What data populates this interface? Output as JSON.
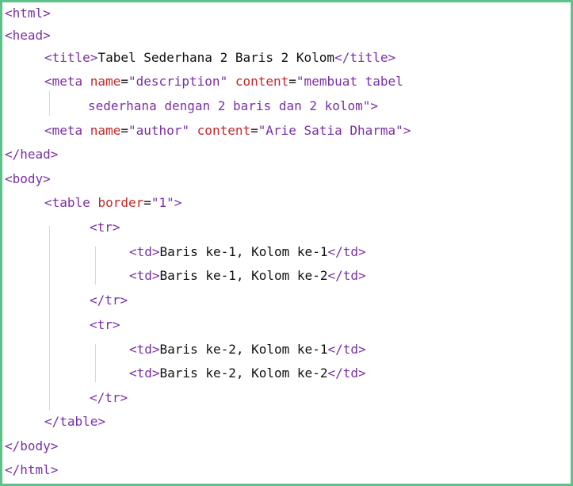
{
  "code_lines": [
    {
      "parts": [
        {
          "t": "tag",
          "s": "<html>"
        }
      ]
    },
    {
      "parts": [
        {
          "t": "tag",
          "s": "<head>"
        }
      ]
    },
    {
      "parts": [
        {
          "t": "tag",
          "s": "<title>"
        },
        {
          "t": "txt",
          "s": "Tabel Sederhana 2 Baris 2 Kolom"
        },
        {
          "t": "tag",
          "s": "</title>"
        }
      ]
    },
    {
      "parts": [
        {
          "t": "tag",
          "s": "<meta "
        },
        {
          "t": "attr",
          "s": "name"
        },
        {
          "t": "eq",
          "s": "="
        },
        {
          "t": "val",
          "s": "\"description\""
        },
        {
          "t": "tag",
          "s": " "
        },
        {
          "t": "attr",
          "s": "content"
        },
        {
          "t": "eq",
          "s": "="
        },
        {
          "t": "val",
          "s": "\"membuat tabel"
        }
      ]
    },
    {
      "parts": [
        {
          "t": "val",
          "s": "sederhana dengan 2 baris dan 2 kolom\""
        },
        {
          "t": "tag",
          "s": ">"
        }
      ]
    },
    {
      "parts": [
        {
          "t": "tag",
          "s": "<meta "
        },
        {
          "t": "attr",
          "s": "name"
        },
        {
          "t": "eq",
          "s": "="
        },
        {
          "t": "val",
          "s": "\"author\""
        },
        {
          "t": "tag",
          "s": " "
        },
        {
          "t": "attr",
          "s": "content"
        },
        {
          "t": "eq",
          "s": "="
        },
        {
          "t": "val",
          "s": "\"Arie Satia Dharma\""
        },
        {
          "t": "tag",
          "s": ">"
        }
      ]
    },
    {
      "parts": [
        {
          "t": "tag",
          "s": "</head>"
        }
      ]
    },
    {
      "parts": [
        {
          "t": "tag",
          "s": "<body>"
        }
      ]
    },
    {
      "parts": [
        {
          "t": "tag",
          "s": "<table "
        },
        {
          "t": "attr",
          "s": "border"
        },
        {
          "t": "eq",
          "s": "="
        },
        {
          "t": "val",
          "s": "\"1\""
        },
        {
          "t": "tag",
          "s": ">"
        }
      ]
    },
    {
      "parts": [
        {
          "t": "tag",
          "s": "<tr>"
        }
      ]
    },
    {
      "parts": [
        {
          "t": "tag",
          "s": "<td>"
        },
        {
          "t": "txt",
          "s": "Baris ke-1, Kolom ke-1"
        },
        {
          "t": "tag",
          "s": "</td>"
        }
      ]
    },
    {
      "parts": [
        {
          "t": "tag",
          "s": "<td>"
        },
        {
          "t": "txt",
          "s": "Baris ke-1, Kolom ke-2"
        },
        {
          "t": "tag",
          "s": "</td>"
        }
      ]
    },
    {
      "parts": [
        {
          "t": "tag",
          "s": "</tr>"
        }
      ]
    },
    {
      "parts": [
        {
          "t": "tag",
          "s": "<tr>"
        }
      ]
    },
    {
      "parts": [
        {
          "t": "tag",
          "s": "<td>"
        },
        {
          "t": "txt",
          "s": "Baris ke-2, Kolom ke-1"
        },
        {
          "t": "tag",
          "s": "</td>"
        }
      ]
    },
    {
      "parts": [
        {
          "t": "tag",
          "s": "<td>"
        },
        {
          "t": "txt",
          "s": "Baris ke-2, Kolom ke-2"
        },
        {
          "t": "tag",
          "s": "</td>"
        }
      ]
    },
    {
      "parts": [
        {
          "t": "tag",
          "s": "</tr>"
        }
      ]
    },
    {
      "parts": [
        {
          "t": "tag",
          "s": "</table>"
        }
      ]
    },
    {
      "parts": [
        {
          "t": "tag",
          "s": "</body>"
        }
      ]
    },
    {
      "parts": [
        {
          "t": "tag",
          "s": "</html>"
        }
      ]
    }
  ],
  "colors": {
    "tag": "#7a2fa6",
    "attribute": "#c42a2a",
    "value": "#7a2fa6",
    "text": "#111111",
    "frame_border": "#5cc28a",
    "indent_guide": "#d9d9d9"
  }
}
